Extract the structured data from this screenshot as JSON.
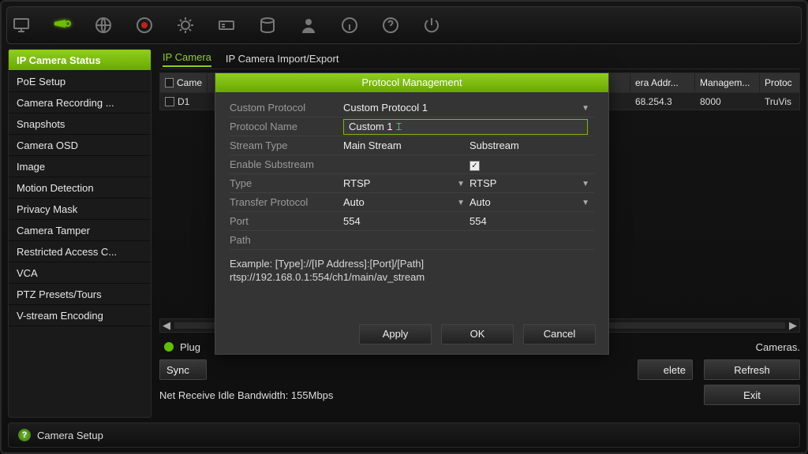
{
  "toolbar_icons": [
    "monitor",
    "camera",
    "globe",
    "record",
    "alarm",
    "card",
    "hdd",
    "user",
    "info",
    "help",
    "power"
  ],
  "sidebar": {
    "items": [
      {
        "label": "IP Camera Status"
      },
      {
        "label": "PoE Setup"
      },
      {
        "label": "Camera Recording ..."
      },
      {
        "label": "Snapshots"
      },
      {
        "label": "Camera OSD"
      },
      {
        "label": "Image"
      },
      {
        "label": "Motion Detection"
      },
      {
        "label": "Privacy Mask"
      },
      {
        "label": "Camera Tamper"
      },
      {
        "label": "Restricted Access C..."
      },
      {
        "label": "VCA"
      },
      {
        "label": "PTZ Presets/Tours"
      },
      {
        "label": "V-stream Encoding"
      }
    ],
    "active_index": 0
  },
  "tabs": [
    {
      "label": "IP Camera"
    },
    {
      "label": "IP Camera Import/Export"
    }
  ],
  "tabs_active_index": 0,
  "table": {
    "headers": {
      "camera_no": "Came",
      "addr": "era Addr...",
      "management": "Managem...",
      "protocol": "Protoc"
    },
    "row": {
      "camera": "D1",
      "addr": "68.254.3",
      "management": "8000",
      "protocol": "TruVis"
    }
  },
  "status_line": {
    "prefix": "Plug",
    "suffix": "Cameras."
  },
  "buttons_bg": {
    "sync": "Sync",
    "delete": "elete",
    "refresh": "Refresh",
    "exit": "Exit"
  },
  "bandwidth": "Net Receive Idle Bandwidth: 155Mbps",
  "dialog": {
    "title": "Protocol Management",
    "fields": {
      "custom_protocol_label": "Custom Protocol",
      "custom_protocol_value": "Custom Protocol 1",
      "protocol_name_label": "Protocol Name",
      "protocol_name_value": "Custom 1",
      "stream_type_label": "Stream Type",
      "stream_main": "Main Stream",
      "stream_sub": "Substream",
      "enable_sub_label": "Enable Substream",
      "enable_sub_checked": true,
      "type_label": "Type",
      "type_main": "RTSP",
      "type_sub": "RTSP",
      "transfer_label": "Transfer Protocol",
      "transfer_main": "Auto",
      "transfer_sub": "Auto",
      "port_label": "Port",
      "port_main": "554",
      "port_sub": "554",
      "path_label": "Path"
    },
    "example_line1": "Example: [Type]://[IP Address]:[Port]/[Path]",
    "example_line2": "rtsp://192.168.0.1:554/ch1/main/av_stream",
    "buttons": {
      "apply": "Apply",
      "ok": "OK",
      "cancel": "Cancel"
    }
  },
  "footer": {
    "label": "Camera Setup"
  }
}
